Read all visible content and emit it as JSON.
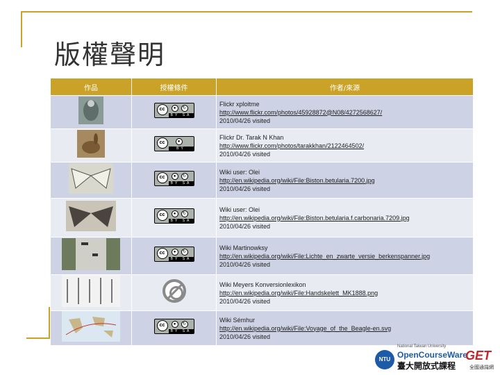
{
  "title": "版權聲明",
  "table": {
    "headers": [
      "作品",
      "授權條件",
      "作者/來源"
    ],
    "rows": [
      {
        "thumb": "bird-photo",
        "license": "cc-by-sa",
        "lines": [
          "Flickr xploitme",
          "http://www.flickr.com/photos/45928872@N08/4272568627/",
          "2010/04/26 visited"
        ]
      },
      {
        "thumb": "rabbit-photo",
        "license": "cc-by",
        "lines": [
          "Flickr Dr. Tarak N Khan",
          "http://www.flickr.com/photos/tarakkhan/2122464502/",
          "2010/04/26 visited"
        ]
      },
      {
        "thumb": "light-moth-photo",
        "license": "cc-by-sa",
        "lines": [
          "Wiki user: Olei",
          "http://en.wikipedia.org/wiki/File:Biston.betularia.7200.jpg",
          "2010/04/26 visited"
        ]
      },
      {
        "thumb": "dark-moth-photo",
        "license": "cc-by-sa",
        "lines": [
          "Wiki user: Olei",
          "http://en.wikipedia.org/wiki/File:Biston.betularia.f.carbonaria.7209.jpg",
          "2010/04/26 visited"
        ]
      },
      {
        "thumb": "tree-bark-photo",
        "license": "cc-by-sa",
        "lines": [
          "Wiki Martinowksy",
          "http://en.wikipedia.org/wiki/File:Lichte_en_zwarte_versie_berkenspanner.jpg",
          "2010/04/26 visited"
        ]
      },
      {
        "thumb": "skeletons-drawing",
        "license": "public-domain",
        "lines": [
          "Wiki Meyers Konversionlexikon",
          "http://en.wikipedia.org/wiki/File:Handskelett_MK1888.png",
          "2010/04/26 visited"
        ]
      },
      {
        "thumb": "world-map",
        "license": "cc-by-sa",
        "lines": [
          "Wiki Sémhur",
          "http://en.wikipedia.org/wiki/File:Voyage_of_the_Beagle-en.svg",
          "2010/04/26 visited"
        ]
      }
    ]
  },
  "license_labels": {
    "cc": "cc",
    "by": "BY",
    "sa": "SA"
  },
  "footer": {
    "ntu": "NTU",
    "university": "National Taiwan University",
    "ocw": "OpenCourseWare",
    "ocw_zh": "臺大開放式課程",
    "get": "GET",
    "get_sub": "全國通識網"
  },
  "colors": {
    "accent": "#c9a227",
    "row_odd": "#cdd3e4",
    "row_even": "#e8ebf2"
  }
}
